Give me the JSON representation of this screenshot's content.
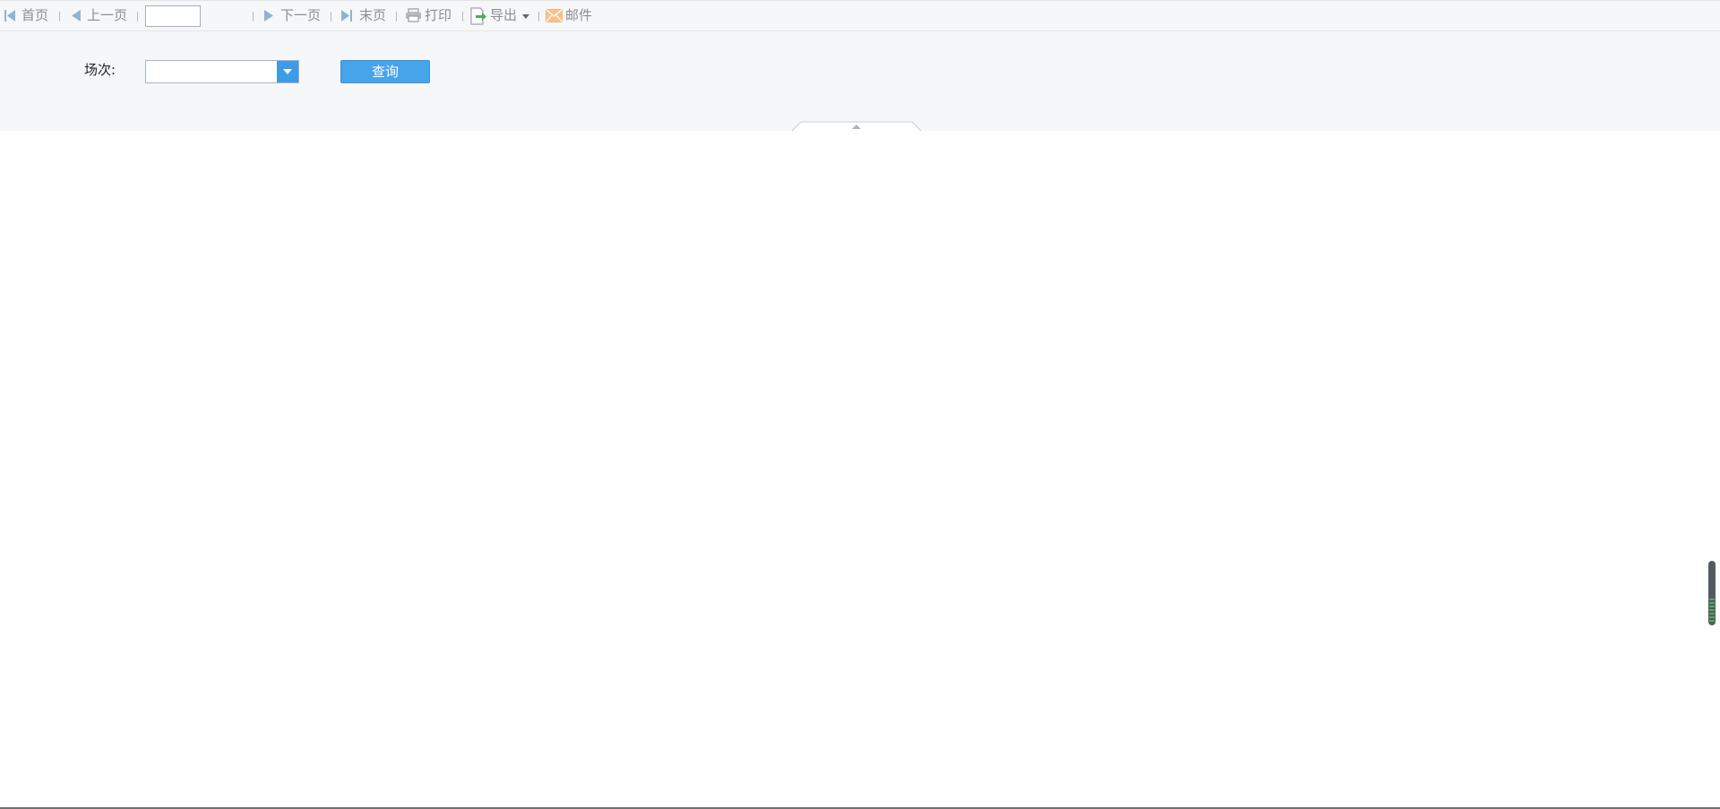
{
  "toolbar": {
    "first": "首页",
    "prev": "上一页",
    "page_input_value": "",
    "next": "下一页",
    "last": "末页",
    "print": "打印",
    "export": "导出",
    "mail": "邮件"
  },
  "params": {
    "session_label": "场次:",
    "session_value": "",
    "query_button": "查询"
  },
  "colors": {
    "accent": "#47a3ea",
    "toolbar_bg": "#f6f7f9",
    "icon_blue": "#8fb3d6",
    "export_green": "#4caf50",
    "mail_orange": "#f0b877"
  }
}
